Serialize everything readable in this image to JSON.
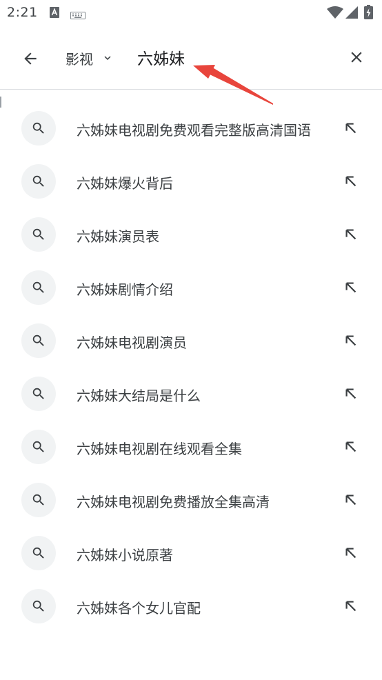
{
  "status_bar": {
    "time": "2:21",
    "icons": [
      "text-notification-icon",
      "keyboard-icon",
      "wifi-icon",
      "cellular-signal-icon",
      "battery-icon"
    ]
  },
  "search": {
    "category": "影视",
    "query": "六姊妹"
  },
  "annotation": {
    "arrow_color": "#e8453c"
  },
  "suggestions": [
    {
      "text": "六姊妹电视剧免费观看完整版高清国语"
    },
    {
      "text": "六姊妹爆火背后"
    },
    {
      "text": "六姊妹演员表"
    },
    {
      "text": "六姊妹剧情介绍"
    },
    {
      "text": "六姊妹电视剧演员"
    },
    {
      "text": "六姊妹大结局是什么"
    },
    {
      "text": "六姊妹电视剧在线观看全集"
    },
    {
      "text": "六姊妹电视剧免费播放全集高清"
    },
    {
      "text": "六姊妹小说原著"
    },
    {
      "text": "六姊妹各个女儿官配"
    }
  ]
}
